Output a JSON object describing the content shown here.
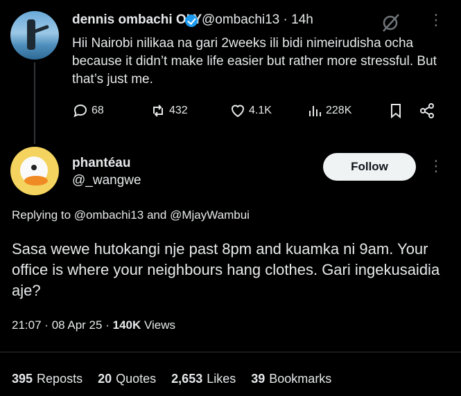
{
  "tweet1": {
    "author_name": "dennis ombachi OLY",
    "handle": "@ombachi13",
    "separator": "·",
    "time": "14h",
    "text": "Hii Nairobi nilikaa na gari 2weeks ili bidi nimeirudisha ocha because it didn’t make life easier but rather more stressful. But that’s just me.",
    "replies": "68",
    "reposts": "432",
    "likes": "4.1K",
    "views": "228K",
    "icons": [
      "reply-icon",
      "repost-icon",
      "like-icon",
      "views-icon",
      "bookmark-icon",
      "share-icon",
      "grok-icon",
      "more-icon",
      "verified-badge"
    ]
  },
  "tweet2": {
    "author_name": "phantéau",
    "handle": "@_wangwe",
    "follow_label": "Follow",
    "replying_prefix": "Replying to",
    "replying_user1": "@ombachi13",
    "replying_and": "and",
    "replying_user2": "@MjayWambui",
    "text": "Sasa wewe hutokangi nje past 8pm and kuamka ni 9am. Your office is where your neighbours hang clothes. Gari ingekusaidia aje?",
    "time": "21:07",
    "sep1": "·",
    "date": "08 Apr 25",
    "sep2": "·",
    "views_count": "140K",
    "views_label": "Views",
    "stats": [
      {
        "count": "395",
        "label": "Reposts"
      },
      {
        "count": "20",
        "label": "Quotes"
      },
      {
        "count": "2,653",
        "label": "Likes"
      },
      {
        "count": "39",
        "label": "Bookmarks"
      }
    ]
  },
  "colors": {
    "background": "#000000",
    "text": "#e7e9ea",
    "muted": "#71767b",
    "verified": "#1d9bf0",
    "follow_bg": "#eff3f4"
  }
}
